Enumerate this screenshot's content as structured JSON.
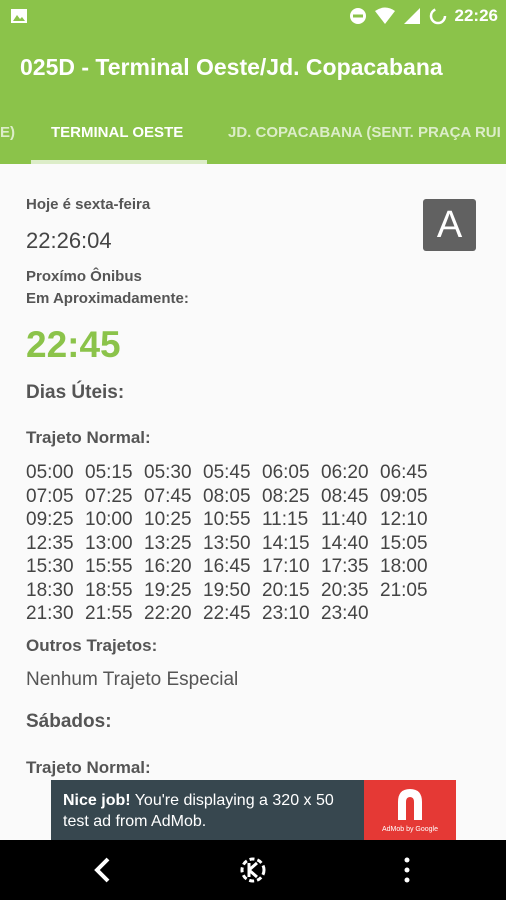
{
  "status_bar": {
    "time": "22:26",
    "icons": [
      "image-icon",
      "do-not-disturb-icon",
      "wifi-icon",
      "signal-icon",
      "sync-icon"
    ]
  },
  "app_bar": {
    "title": "025D - Terminal Oeste/Jd. Copacabana"
  },
  "tabs": [
    {
      "label": "E)"
    },
    {
      "label": "TERMINAL OESTE"
    },
    {
      "label": "JD. COPACABANA (SENT. PRAÇA RUI BARBOSA)"
    }
  ],
  "info": {
    "today_label": "Hoje é sexta-feira",
    "current_time": "22:26:04",
    "next_bus_label_1": "Proxímo Ônibus",
    "next_bus_label_2": "Em Aproximadamente:",
    "next_bus_time": "22:45",
    "badge": "A"
  },
  "schedule": {
    "weekdays_title": "Dias Úteis:",
    "normal_title": "Trajeto Normal:",
    "weekday_times": [
      "05:00",
      "05:15",
      "05:30",
      "05:45",
      "06:05",
      "06:20",
      "06:45",
      "07:05",
      "07:25",
      "07:45",
      "08:05",
      "08:25",
      "08:45",
      "09:05",
      "09:25",
      "10:00",
      "10:25",
      "10:55",
      "11:15",
      "11:40",
      "12:10",
      "12:35",
      "13:00",
      "13:25",
      "13:50",
      "14:15",
      "14:40",
      "15:05",
      "15:30",
      "15:55",
      "16:20",
      "16:45",
      "17:10",
      "17:35",
      "18:00",
      "18:30",
      "18:55",
      "19:25",
      "19:50",
      "20:15",
      "20:35",
      "21:05",
      "21:30",
      "21:55",
      "22:20",
      "22:45",
      "23:10",
      "23:40"
    ],
    "other_title": "Outros Trajetos:",
    "other_value": "Nenhum Trajeto Especial",
    "saturday_title": "Sábados:",
    "saturday_normal_title": "Trajeto Normal:"
  },
  "ad": {
    "bold": "Nice job!",
    "text": " You're displaying a 320 x 50 test ad from AdMob.",
    "caption": "AdMob by Google"
  },
  "colors": {
    "primary": "#8bc34a",
    "indicator": "#dcedc8",
    "ad_bg": "#37474f",
    "ad_logo": "#e53935"
  }
}
